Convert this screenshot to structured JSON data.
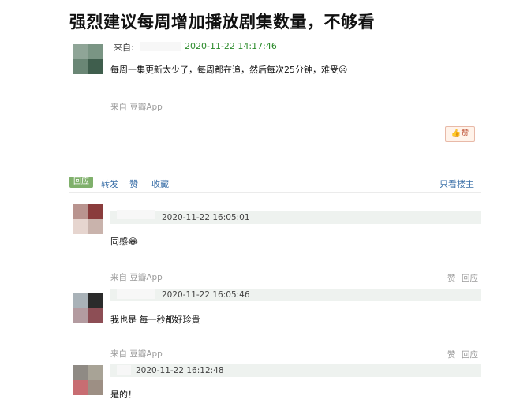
{
  "post": {
    "title": "强烈建议每周增加播放剧集数量，不够看",
    "from_label": "来自:",
    "timestamp": "2020-11-22 14:17:46",
    "body": "每周一集更新太少了，每周都在追，然后每次25分钟，难受☹",
    "source": "来自 豆瓣App",
    "like_label": "赞",
    "avatar_colors": [
      "#8fa597",
      "#7a9584",
      "#6a8675",
      "#3f5e4d"
    ]
  },
  "actions": {
    "reply": "回应",
    "repost": "转发",
    "like": "赞",
    "collect": "收藏",
    "only_op": "只看楼主"
  },
  "replies": [
    {
      "time": "2020-11-22 16:05:01",
      "text": "同感😂",
      "source": "来自 豆瓣App",
      "like": "赞",
      "reply": "回应",
      "avatar_colors": [
        "#b9948f",
        "#8a3c3c",
        "#e6d5cf",
        "#c9b3ac"
      ]
    },
    {
      "time": "2020-11-22 16:05:46",
      "text": "我也是 每一秒都好珍貴",
      "source": "来自 豆瓣App",
      "like": "赞",
      "reply": "回应",
      "avatar_colors": [
        "#a9b2b8",
        "#2b2b2b",
        "#b39ba0",
        "#8d4e55"
      ]
    },
    {
      "time": "2020-11-22 16:12:48",
      "text": "是的！",
      "avatar_colors": [
        "#8f8a84",
        "#a8a396",
        "#c86d72",
        "#9d8f84"
      ]
    }
  ]
}
